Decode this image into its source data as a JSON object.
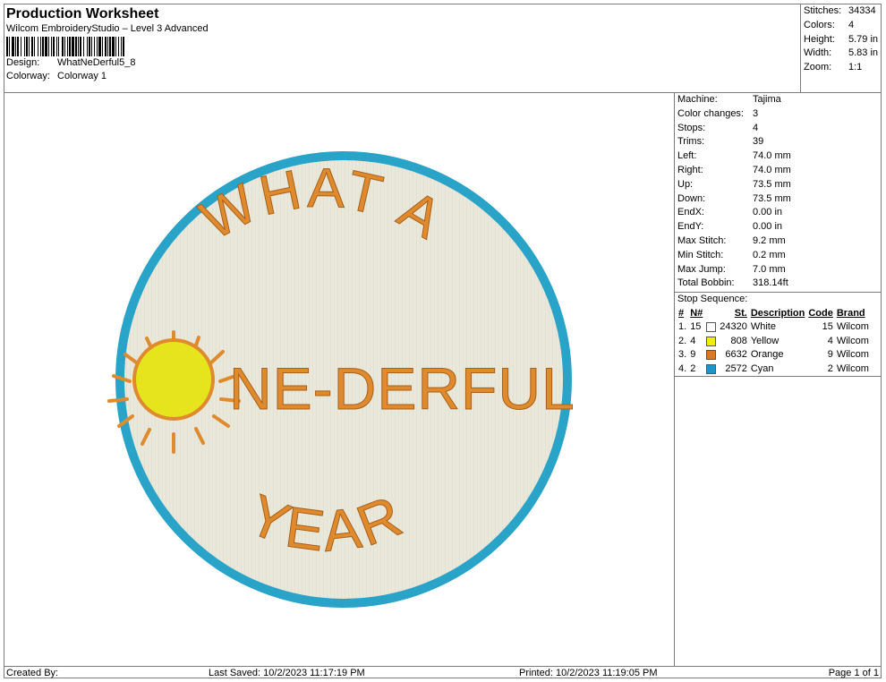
{
  "header": {
    "title": "Production Worksheet",
    "subtitle": "Wilcom EmbroideryStudio – Level 3 Advanced",
    "design_label": "Design:",
    "design_value": "WhatNeDerful5_8",
    "colorway_label": "Colorway:",
    "colorway_value": "Colorway 1"
  },
  "stats": [
    {
      "k": "Stitches:",
      "v": "34334"
    },
    {
      "k": "Colors:",
      "v": "4"
    },
    {
      "k": "Height:",
      "v": "5.79 in"
    },
    {
      "k": "Width:",
      "v": "5.83 in"
    },
    {
      "k": "Zoom:",
      "v": "1:1"
    }
  ],
  "machine_info": [
    {
      "k": "Machine:",
      "v": "Tajima"
    },
    {
      "k": "Color changes:",
      "v": "3"
    },
    {
      "k": "Stops:",
      "v": "4"
    },
    {
      "k": "Trims:",
      "v": "39"
    },
    {
      "k": "Left:",
      "v": "74.0 mm"
    },
    {
      "k": "Right:",
      "v": "74.0 mm"
    },
    {
      "k": "Up:",
      "v": "73.5 mm"
    },
    {
      "k": "Down:",
      "v": "73.5 mm"
    },
    {
      "k": "EndX:",
      "v": "0.00 in"
    },
    {
      "k": "EndY:",
      "v": "0.00 in"
    },
    {
      "k": "Max Stitch:",
      "v": "9.2 mm"
    },
    {
      "k": "Min Stitch:",
      "v": "0.2 mm"
    },
    {
      "k": "Max Jump:",
      "v": "7.0 mm"
    },
    {
      "k": "Total Bobbin:",
      "v": "318.14ft"
    }
  ],
  "stop_sequence": {
    "title": "Stop Sequence:",
    "headers": {
      "num": "#",
      "n": "N#",
      "st": "St.",
      "desc": "Description",
      "code": "Code",
      "brand": "Brand"
    },
    "rows": [
      {
        "num": "1.",
        "n": "15",
        "color": "#ffffff",
        "st": "24320",
        "desc": "White",
        "code": "15",
        "brand": "Wilcom"
      },
      {
        "num": "2.",
        "n": "4",
        "color": "#f2ee00",
        "st": "808",
        "desc": "Yellow",
        "code": "4",
        "brand": "Wilcom"
      },
      {
        "num": "3.",
        "n": "9",
        "color": "#d97a22",
        "st": "6632",
        "desc": "Orange",
        "code": "9",
        "brand": "Wilcom"
      },
      {
        "num": "4.",
        "n": "2",
        "color": "#1a96c8",
        "st": "2572",
        "desc": "Cyan",
        "code": "2",
        "brand": "Wilcom"
      }
    ]
  },
  "design_art": {
    "line1": "WHAT A",
    "line2": "NE-DERFUL",
    "line3": "YEAR",
    "colors": {
      "fill": "#e9e8da",
      "ring": "#2aa3c9",
      "text": "#e08a2e",
      "sun": "#e6e41c"
    }
  },
  "footer": {
    "created": "Created By:",
    "saved": "Last Saved: 10/2/2023 11:17:19 PM",
    "printed": "Printed: 10/2/2023 11:19:05 PM",
    "page": "Page 1 of 1"
  }
}
